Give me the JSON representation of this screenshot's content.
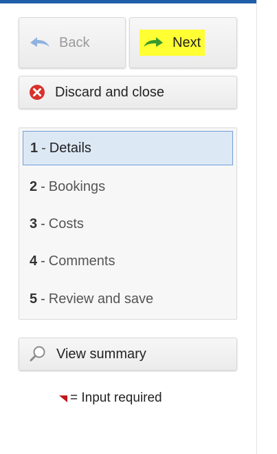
{
  "nav": {
    "back_label": "Back",
    "next_label": "Next",
    "discard_label": "Discard and close"
  },
  "steps": [
    {
      "num": "1",
      "label": "Details",
      "active": true
    },
    {
      "num": "2",
      "label": "Bookings",
      "active": false
    },
    {
      "num": "3",
      "label": "Costs",
      "active": false
    },
    {
      "num": "4",
      "label": "Comments",
      "active": false
    },
    {
      "num": "5",
      "label": "Review and save",
      "active": false
    }
  ],
  "step_separator": "-",
  "summary": {
    "label": "View summary"
  },
  "legend": {
    "text": "= Input required"
  },
  "colors": {
    "top_bar": "#1f5fa8",
    "highlight": "#ffff33",
    "active_step_bg": "#dde8f5",
    "active_step_border": "#6fa0d8",
    "discard_icon": "#d9322c",
    "next_arrow": "#3a9a2b",
    "back_arrow": "#8fb3e0",
    "required_marker": "#c0171a"
  },
  "icons": {
    "back": "left-arrow-icon",
    "next": "right-arrow-icon",
    "discard": "close-circle-icon",
    "summary": "magnifier-icon",
    "required": "required-marker-icon"
  }
}
